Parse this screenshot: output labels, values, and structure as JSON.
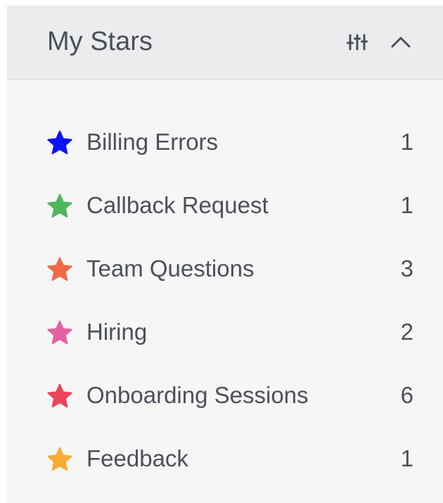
{
  "header": {
    "title": "My Stars",
    "filter_icon": "sliders-icon",
    "collapse_icon": "chevron-up-icon"
  },
  "colors": {
    "header_bg": "#ebecee",
    "panel_bg": "#f6f6f7",
    "text": "#4b505a"
  },
  "stars": [
    {
      "label": "Billing Errors",
      "count": "1",
      "color": "#0a14f5"
    },
    {
      "label": "Callback Request",
      "count": "1",
      "color": "#4fb75a"
    },
    {
      "label": "Team Questions",
      "count": "3",
      "color": "#ef6b45"
    },
    {
      "label": "Hiring",
      "count": "2",
      "color": "#e461a4"
    },
    {
      "label": "Onboarding Sessions",
      "count": "6",
      "color": "#ec4458"
    },
    {
      "label": "Feedback",
      "count": "1",
      "color": "#f8ab35"
    }
  ]
}
